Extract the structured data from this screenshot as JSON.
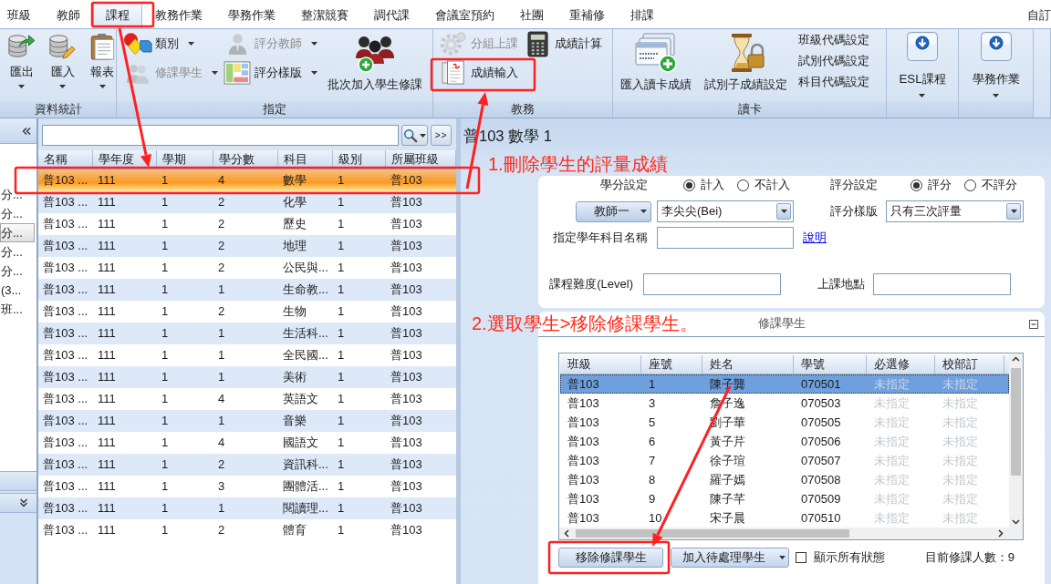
{
  "menu_tabs": [
    {
      "label": "班級",
      "selected": false
    },
    {
      "label": "教師",
      "selected": false
    },
    {
      "label": "課程",
      "selected": true
    },
    {
      "label": "教務作業",
      "selected": false
    },
    {
      "label": "學務作業",
      "selected": false
    },
    {
      "label": "整潔競賽",
      "selected": false
    },
    {
      "label": "調代課",
      "selected": false
    },
    {
      "label": "會議室預約",
      "selected": false
    },
    {
      "label": "社團",
      "selected": false
    },
    {
      "label": "重補修",
      "selected": false
    },
    {
      "label": "排課",
      "selected": false
    }
  ],
  "menu_right_tab": {
    "label": "自訂",
    "selected": false
  },
  "ribbon": {
    "groups": [
      {
        "label": "資料統計",
        "columns": [
          [
            {
              "label": "匯出",
              "kind": "large",
              "dropdown": true,
              "disabled": false
            }
          ],
          [
            {
              "label": "匯入",
              "kind": "large",
              "dropdown": true,
              "disabled": false
            }
          ],
          [
            {
              "label": "報表",
              "kind": "large",
              "dropdown": true,
              "disabled": false
            }
          ]
        ]
      },
      {
        "label": "指定",
        "columns": [
          [
            {
              "label": "類別",
              "kind": "small",
              "dropdown": true,
              "disabled": false
            },
            {
              "label": "修課學生",
              "kind": "small",
              "dropdown": true,
              "disabled": true
            }
          ],
          [
            {
              "label": "評分教師",
              "kind": "small",
              "dropdown": true,
              "disabled": true
            },
            {
              "label": "評分樣版",
              "kind": "small",
              "dropdown": true,
              "disabled": false
            }
          ],
          [
            {
              "label": "批次加入學生修課",
              "kind": "large",
              "dropdown": false,
              "disabled": false
            }
          ]
        ]
      },
      {
        "label": "教務",
        "columns": [
          [
            {
              "label": "分組上課",
              "kind": "small",
              "dropdown": false,
              "disabled": true
            },
            {
              "label": "成績輸入",
              "kind": "small",
              "dropdown": false,
              "disabled": false
            }
          ],
          [
            {
              "label": "成績計算",
              "kind": "small",
              "dropdown": false,
              "disabled": false
            }
          ]
        ]
      },
      {
        "label": "讀卡",
        "columns": [
          [
            {
              "label": "匯入讀卡成績",
              "kind": "large",
              "dropdown": false,
              "disabled": false
            }
          ],
          [
            {
              "label": "試別子成績設定",
              "kind": "large",
              "dropdown": false,
              "disabled": false
            }
          ],
          [
            {
              "label": "班級代碼設定",
              "kind": "text",
              "dropdown": false,
              "disabled": false
            },
            {
              "label": "試別代碼設定",
              "kind": "text",
              "dropdown": false,
              "disabled": false
            },
            {
              "label": "科目代碼設定",
              "kind": "text",
              "dropdown": false,
              "disabled": false
            }
          ]
        ]
      },
      {
        "columns": [
          [
            {
              "label": "ESL課程",
              "kind": "tile",
              "dropdown": true,
              "disabled": false
            }
          ]
        ]
      },
      {
        "columns": [
          [
            {
              "label": "學務作業",
              "kind": "tile",
              "dropdown": true,
              "disabled": false
            }
          ]
        ]
      }
    ]
  },
  "nav_pane": {
    "items": [
      {
        "label": "分...",
        "selected": false
      },
      {
        "label": "分...",
        "selected": false
      },
      {
        "label": "分...",
        "selected": true
      },
      {
        "label": "分...",
        "selected": false
      },
      {
        "label": "分...",
        "selected": false
      },
      {
        "label": "(3...",
        "selected": false
      },
      {
        "label": "班...",
        "selected": false
      }
    ]
  },
  "course_grid": {
    "more_button": ">>",
    "columns": [
      "名稱",
      "學年度",
      "學期",
      "學分數",
      "科目",
      "級別",
      "所屬班級"
    ],
    "rows": [
      {
        "cells": [
          "普103 ...",
          "111",
          "1",
          "4",
          "數學",
          "1",
          "普103"
        ],
        "selected": true
      },
      {
        "cells": [
          "普103 ...",
          "111",
          "1",
          "2",
          "化學",
          "1",
          "普103"
        ],
        "selected": false
      },
      {
        "cells": [
          "普103 ...",
          "111",
          "1",
          "2",
          "歷史",
          "1",
          "普103"
        ],
        "selected": false
      },
      {
        "cells": [
          "普103 ...",
          "111",
          "1",
          "2",
          "地理",
          "1",
          "普103"
        ],
        "selected": false
      },
      {
        "cells": [
          "普103 ...",
          "111",
          "1",
          "2",
          "公民與...",
          "1",
          "普103"
        ],
        "selected": false
      },
      {
        "cells": [
          "普103 ...",
          "111",
          "1",
          "1",
          "生命教...",
          "1",
          "普103"
        ],
        "selected": false
      },
      {
        "cells": [
          "普103 ...",
          "111",
          "1",
          "2",
          "生物",
          "1",
          "普103"
        ],
        "selected": false
      },
      {
        "cells": [
          "普103 ...",
          "111",
          "1",
          "1",
          "生活科...",
          "1",
          "普103"
        ],
        "selected": false
      },
      {
        "cells": [
          "普103 ...",
          "111",
          "1",
          "1",
          "全民國...",
          "1",
          "普103"
        ],
        "selected": false
      },
      {
        "cells": [
          "普103 ...",
          "111",
          "1",
          "1",
          "美術",
          "1",
          "普103"
        ],
        "selected": false
      },
      {
        "cells": [
          "普103 ...",
          "111",
          "1",
          "4",
          "英語文",
          "1",
          "普103"
        ],
        "selected": false
      },
      {
        "cells": [
          "普103 ...",
          "111",
          "1",
          "1",
          "音樂",
          "1",
          "普103"
        ],
        "selected": false
      },
      {
        "cells": [
          "普103 ...",
          "111",
          "1",
          "4",
          "國語文",
          "1",
          "普103"
        ],
        "selected": false
      },
      {
        "cells": [
          "普103 ...",
          "111",
          "1",
          "2",
          "資訊科...",
          "1",
          "普103"
        ],
        "selected": false
      },
      {
        "cells": [
          "普103 ...",
          "111",
          "1",
          "3",
          "團體活...",
          "1",
          "普103"
        ],
        "selected": false
      },
      {
        "cells": [
          "普103 ...",
          "111",
          "1",
          "1",
          "閱讀理...",
          "1",
          "普103"
        ],
        "selected": false
      },
      {
        "cells": [
          "普103 ...",
          "111",
          "1",
          "2",
          "體育",
          "1",
          "普103"
        ],
        "selected": false
      }
    ]
  },
  "detail": {
    "title": "普103 數學 1",
    "annotation": "1.刪除學生的評量成績",
    "form": {
      "credit_setting": {
        "label": "學分設定",
        "options": [
          {
            "label": "計入",
            "selected": true
          },
          {
            "label": "不計入",
            "selected": false
          }
        ]
      },
      "grading_setting": {
        "label": "評分設定",
        "options": [
          {
            "label": "評分",
            "selected": true
          },
          {
            "label": "不評分",
            "selected": false
          }
        ]
      },
      "teacher": {
        "button": "教師一",
        "value": "李尖尖(Bei)"
      },
      "grading_template": {
        "label": "評分樣版",
        "value": "只有三次評量"
      },
      "subject_name": {
        "label": "指定學年科目名稱",
        "link": "說明"
      },
      "difficulty": {
        "label": "課程難度(Level)"
      },
      "location": {
        "label": "上課地點"
      }
    },
    "students": {
      "annotation": "2.選取學生>移除修課學生。",
      "title": "修課學生",
      "expanded": true,
      "columns": [
        {
          "label": "班級",
          "muted": false
        },
        {
          "label": "座號",
          "muted": false
        },
        {
          "label": "姓名",
          "muted": false
        },
        {
          "label": "學號",
          "muted": false
        },
        {
          "label": "必選修",
          "muted": true
        },
        {
          "label": "校部訂",
          "muted": true
        }
      ],
      "rows": [
        {
          "cells": [
            "普103",
            "1",
            "陳子龔",
            "070501",
            "未指定",
            "未指定"
          ],
          "selected": true
        },
        {
          "cells": [
            "普103",
            "3",
            "詹子逸",
            "070503",
            "未指定",
            "未指定"
          ],
          "selected": false
        },
        {
          "cells": [
            "普103",
            "5",
            "劉子華",
            "070505",
            "未指定",
            "未指定"
          ],
          "selected": false
        },
        {
          "cells": [
            "普103",
            "6",
            "黃子芹",
            "070506",
            "未指定",
            "未指定"
          ],
          "selected": false
        },
        {
          "cells": [
            "普103",
            "7",
            "徐子瑄",
            "070507",
            "未指定",
            "未指定"
          ],
          "selected": false
        },
        {
          "cells": [
            "普103",
            "8",
            "羅子嫣",
            "070508",
            "未指定",
            "未指定"
          ],
          "selected": false
        },
        {
          "cells": [
            "普103",
            "9",
            "陳子芊",
            "070509",
            "未指定",
            "未指定"
          ],
          "selected": false
        },
        {
          "cells": [
            "普103",
            "10",
            "宋子晨",
            "070510",
            "未指定",
            "未指定"
          ],
          "selected": false
        }
      ],
      "remove_button": "移除修課學生",
      "add_pending_button": "加入待處理學生",
      "show_all": {
        "label": "顯示所有狀態",
        "checked": false
      },
      "count": "目前修課人數：9"
    }
  }
}
